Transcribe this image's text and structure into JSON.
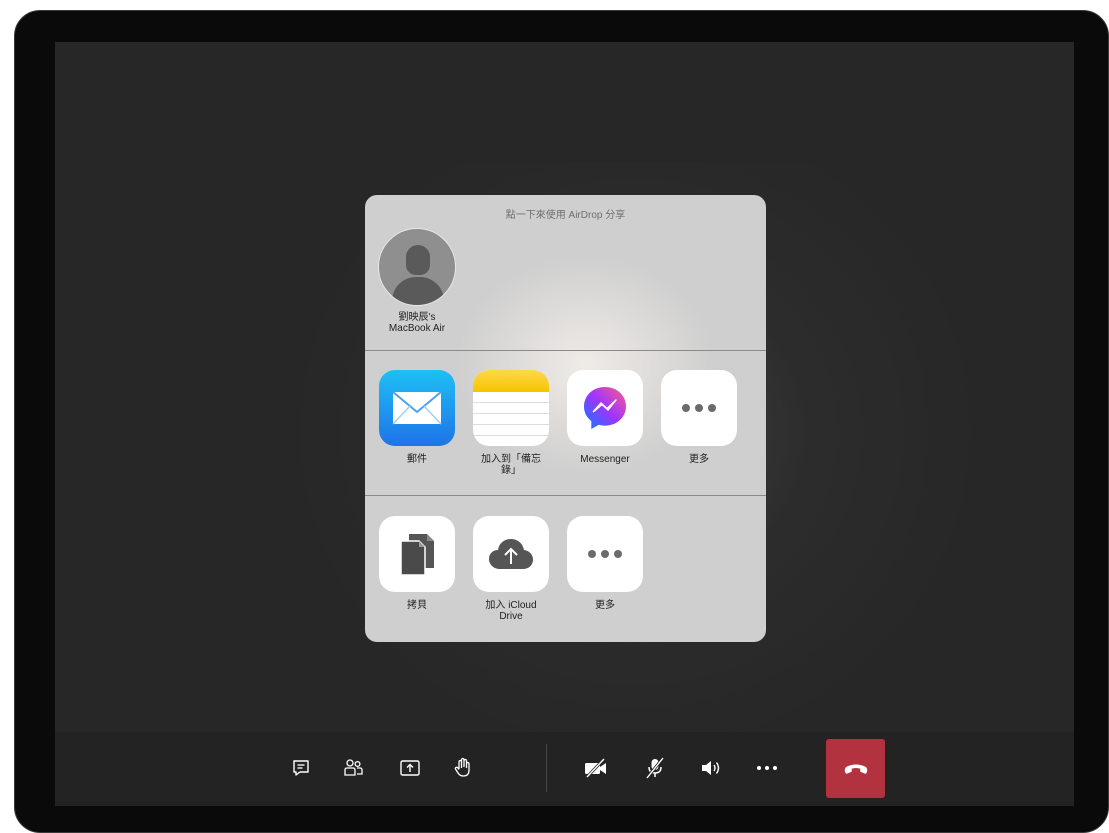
{
  "share_sheet": {
    "airdrop_title": "點一下來使用 AirDrop 分享",
    "airdrop_target": {
      "name_line1": "劉映辰's",
      "name_line2": "MacBook Air",
      "icon": "person-silhouette-icon"
    },
    "apps": [
      {
        "label": "郵件",
        "icon": "mail-icon"
      },
      {
        "label_line1": "加入到「備忘",
        "label_line2": "錄」",
        "icon": "notes-icon"
      },
      {
        "label": "Messenger",
        "icon": "messenger-icon"
      },
      {
        "label": "更多",
        "icon": "more-dots-icon"
      }
    ],
    "actions": [
      {
        "label": "拷貝",
        "icon": "copy-icon"
      },
      {
        "label_line1": "加入 iCloud",
        "label_line2": "Drive",
        "icon": "icloud-upload-icon"
      },
      {
        "label": "更多",
        "icon": "more-dots-icon"
      }
    ]
  },
  "toolbar": {
    "buttons": [
      {
        "name": "chat-icon"
      },
      {
        "name": "participants-icon"
      },
      {
        "name": "share-screen-icon"
      },
      {
        "name": "raise-hand-icon"
      },
      {
        "name": "camera-off-icon"
      },
      {
        "name": "mic-muted-icon"
      },
      {
        "name": "speaker-icon"
      },
      {
        "name": "more-options-icon"
      },
      {
        "name": "hang-up-icon"
      }
    ],
    "hangup_color": "#b3323f"
  },
  "colors": {
    "background": "#272727",
    "sheet": "#cfcfcf",
    "mail_gradient_top": "#1dc0f5",
    "mail_gradient_bottom": "#1f74e8",
    "notes_yellow": "#f5c400"
  }
}
